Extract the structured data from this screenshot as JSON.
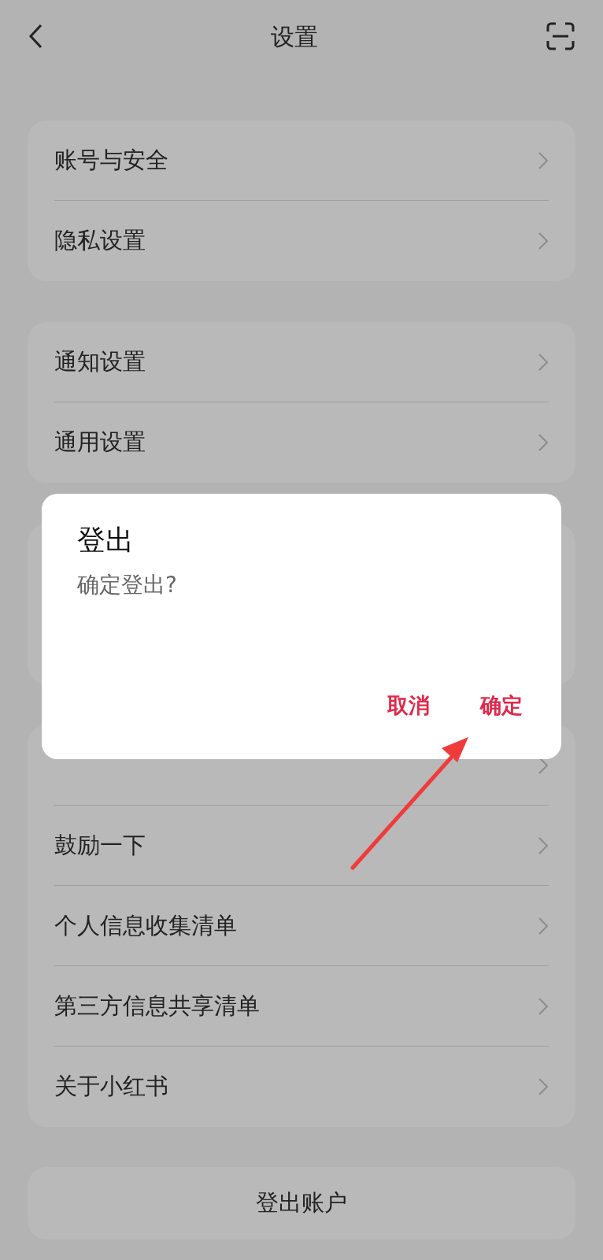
{
  "header": {
    "title": "设置"
  },
  "groups": [
    {
      "items": [
        "账号与安全",
        "隐私设置"
      ]
    },
    {
      "items": [
        "通知设置",
        "通用设置"
      ]
    },
    {
      "items": [
        "鼓励一下",
        "个人信息收集清单",
        "第三方信息共享清单",
        "关于小红书"
      ]
    }
  ],
  "logout_button": "登出账户",
  "dialog": {
    "title": "登出",
    "message": "确定登出?",
    "buttons": [
      "取消",
      "确定"
    ]
  }
}
